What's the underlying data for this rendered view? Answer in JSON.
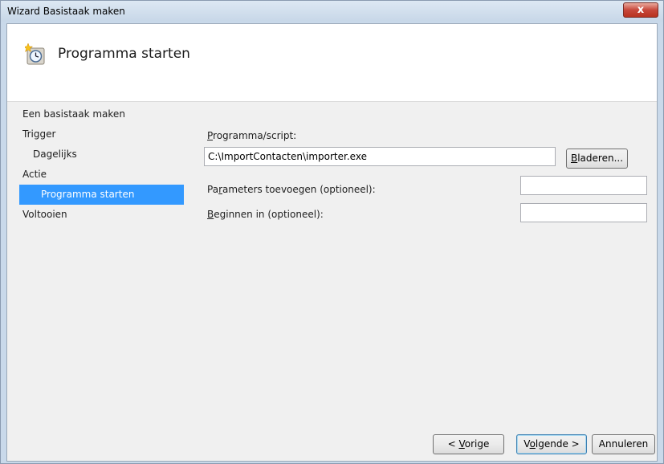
{
  "window": {
    "title": "Wizard Basistaak maken",
    "close_label": "x"
  },
  "header": {
    "title": "Programma starten",
    "icon": "clock-icon"
  },
  "nav": {
    "items": [
      {
        "label": "Een basistaak maken",
        "indent": 0,
        "selected": false
      },
      {
        "label": "Trigger",
        "indent": 0,
        "selected": false
      },
      {
        "label": "Dagelijks",
        "indent": 1,
        "selected": false
      },
      {
        "label": "Actie",
        "indent": 0,
        "selected": false
      },
      {
        "label": "Programma starten",
        "indent": 1,
        "selected": true
      },
      {
        "label": "Voltooien",
        "indent": 0,
        "selected": false
      }
    ]
  },
  "form": {
    "program_label_u": "P",
    "program_label_rest": "rogramma/script:",
    "program_value": "C:\\ImportContacten\\importer.exe",
    "browse_u": "B",
    "browse_rest": "laderen...",
    "params_label_a": "Pa",
    "params_label_u": "r",
    "params_label_rest": "ameters toevoegen (optioneel):",
    "params_value": "",
    "start_label_u": "B",
    "start_label_rest": "eginnen in (optioneel):",
    "start_value": ""
  },
  "footer": {
    "back_pre": "< ",
    "back_u": "V",
    "back_rest": "orige",
    "next_pre": "V",
    "next_u": "o",
    "next_rest": "lgende >",
    "cancel": "Annuleren"
  }
}
